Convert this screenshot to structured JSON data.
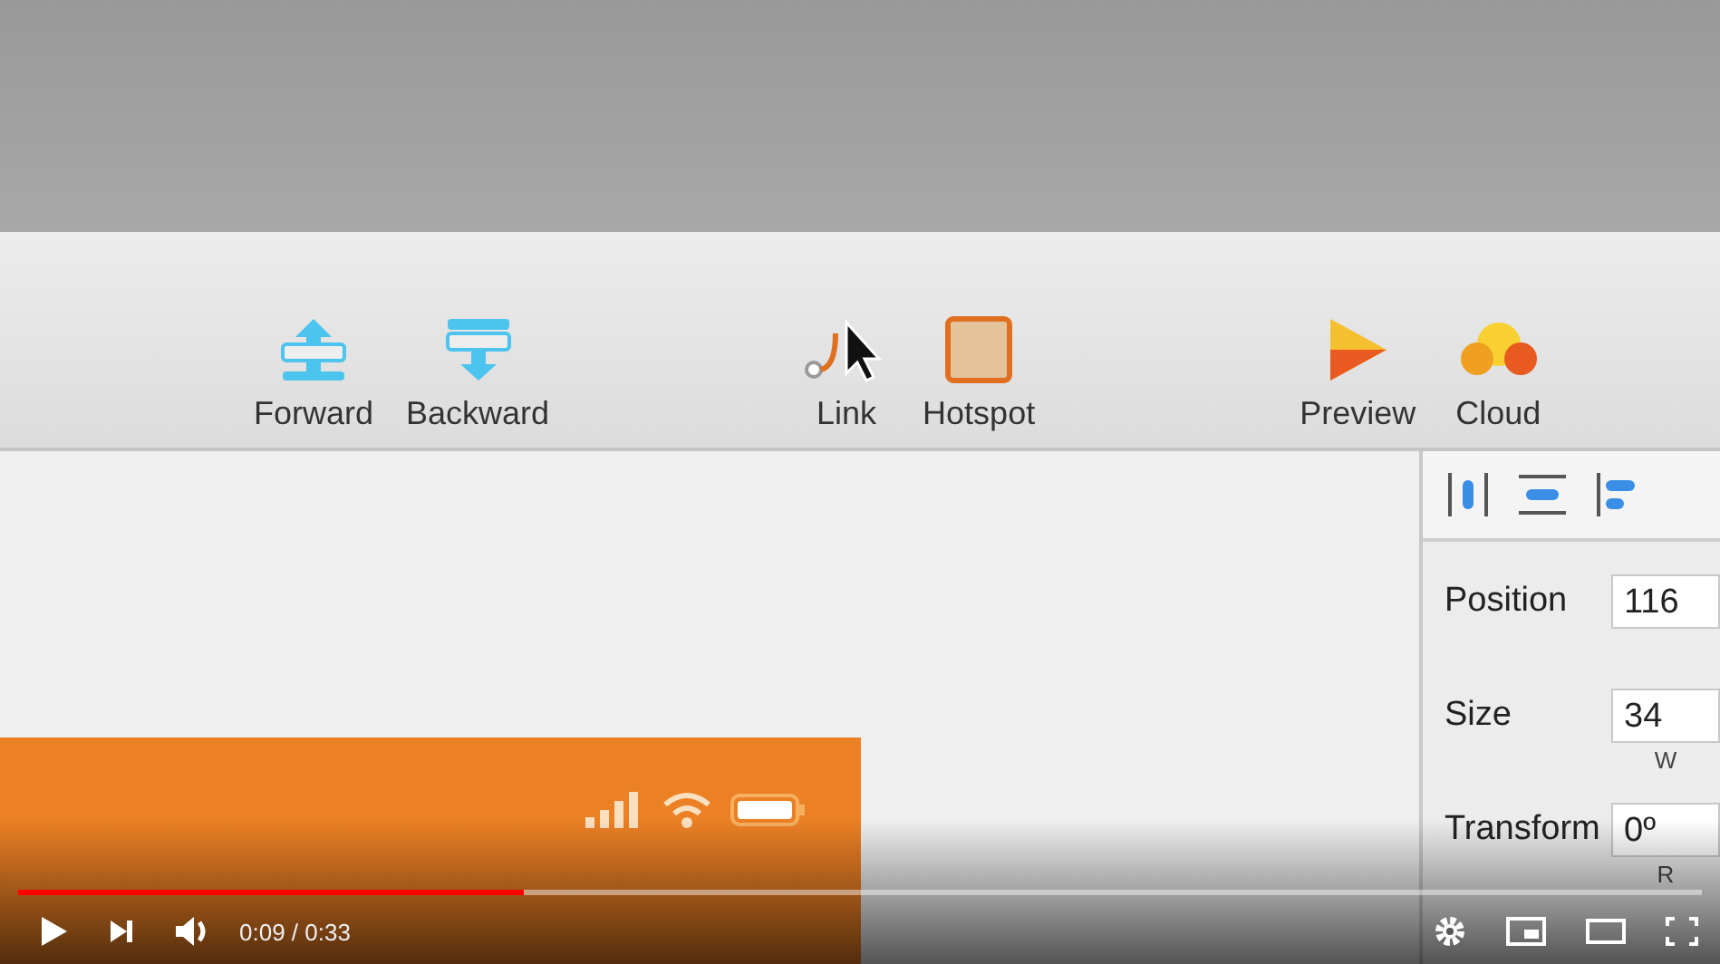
{
  "toolbar": {
    "items": [
      {
        "label": "Forward",
        "kind": "forward"
      },
      {
        "label": "Backward",
        "kind": "backward"
      },
      {
        "label": "Link",
        "kind": "link"
      },
      {
        "label": "Hotspot",
        "kind": "hotspot"
      },
      {
        "label": "Preview",
        "kind": "preview"
      },
      {
        "label": "Cloud",
        "kind": "cloud"
      }
    ]
  },
  "inspector": {
    "rows": [
      {
        "label": "Position",
        "value": "116"
      },
      {
        "label": "Size",
        "value": "34",
        "caption": "W"
      },
      {
        "label": "Transform",
        "value": "0º",
        "caption": "R"
      }
    ]
  },
  "player": {
    "progress": {
      "level": 0.3
    },
    "time": "0:09 / 0:33"
  }
}
